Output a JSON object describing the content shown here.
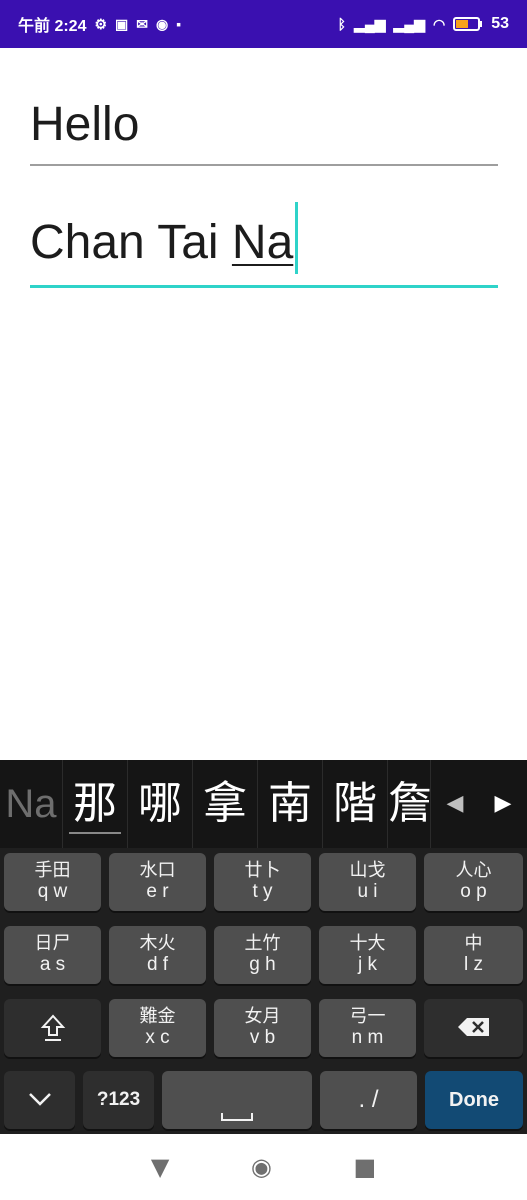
{
  "status_bar": {
    "time": "午前 2:24",
    "left_icons": [
      "settings-icon",
      "image-icon",
      "mail-icon",
      "chat-icon",
      "lock-icon"
    ],
    "right_icons": [
      "bluetooth-icon",
      "signal-icon",
      "signal-icon",
      "wifi-icon",
      "battery-icon"
    ],
    "battery_text": "53"
  },
  "fields": [
    {
      "text": "Hello"
    },
    {
      "prefix": "Chan Tai ",
      "composing": "Na"
    }
  ],
  "candidate_bar": {
    "composing": "Na",
    "candidates": [
      "那",
      "哪",
      "拿",
      "南",
      "階",
      "詹"
    ]
  },
  "keyboard": {
    "rows": [
      [
        {
          "cj": "手田",
          "lat": "q w"
        },
        {
          "cj": "水口",
          "lat": "e r"
        },
        {
          "cj": "廿卜",
          "lat": "t y"
        },
        {
          "cj": "山戈",
          "lat": "u i"
        },
        {
          "cj": "人心",
          "lat": "o p"
        }
      ],
      [
        {
          "cj": "日尸",
          "lat": "a s"
        },
        {
          "cj": "木火",
          "lat": "d f"
        },
        {
          "cj": "土竹",
          "lat": "g h"
        },
        {
          "cj": "十大",
          "lat": "j k"
        },
        {
          "cj": "中",
          "lat": "l z"
        }
      ],
      [
        {
          "cj": "難金",
          "lat": "x c"
        },
        {
          "cj": "女月",
          "lat": "v b"
        },
        {
          "cj": "弓一",
          "lat": "n m"
        }
      ]
    ],
    "symbols_label": "?123",
    "punct_label": ". /",
    "done_label": "Done",
    "accent_color": "#124a74"
  },
  "colors": {
    "status_bar": "#3a10b0",
    "focus_underline": "#2fd3c9"
  }
}
